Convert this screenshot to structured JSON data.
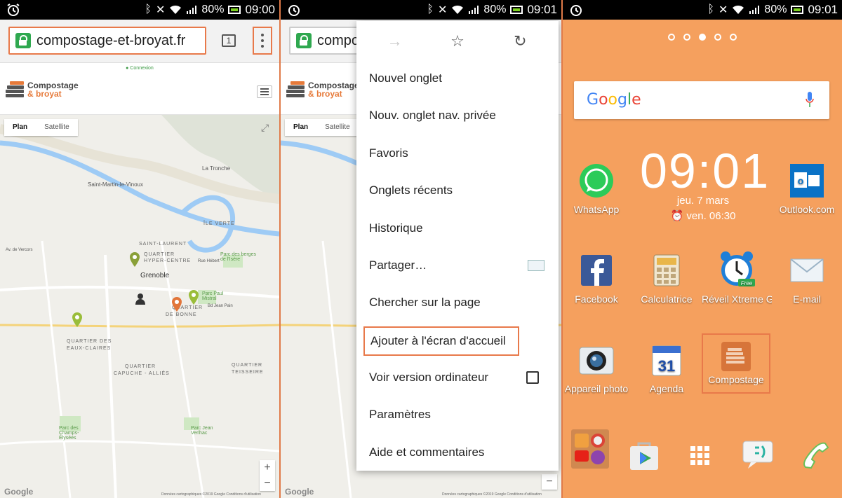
{
  "panel1": {
    "status": {
      "battery": "80%",
      "time": "09:00"
    },
    "url": "compostage-et-broyat.fr",
    "tab_count": "1",
    "site": {
      "login": "Connexion",
      "logo_line1": "Compostage",
      "logo_line2": "& broyat"
    },
    "map": {
      "type_plan": "Plan",
      "type_satellite": "Satellite",
      "labels": {
        "la_tronche": "La Tronche",
        "saint_martin": "Saint-Martin-le-Vinoux",
        "ile_verte": "ÎLE VERTE",
        "saint_laurent": "SAINT-LAURENT",
        "quartier_hyper": "QUARTIER",
        "hyper_centre": "HYPER-CENTRE",
        "grenoble": "Grenoble",
        "parc_berges": "Parc des berges de l'Isère",
        "parc_paul": "Parc Paul Mistral",
        "quartier_bonne": "QUARTIER",
        "de_bonne": "DE BONNE",
        "eaux_claires_1": "QUARTIER DES",
        "eaux_claires_2": "EAUX-CLAIRES",
        "capuche_1": "QUARTIER",
        "capuche_2": "CAPUCHE - ALLIÉS",
        "teisseire_1": "QUARTIER",
        "teisseire_2": "TEISSEIRE",
        "parc_champs": "Parc des Champs-Élysées",
        "parc_jean": "Parc Jean Verlhac",
        "av_vercors": "Av. de Vercors",
        "bd_jean_pain": "Bd Jean Pain",
        "rue_hebert": "Rue Hébert"
      },
      "footer": "Données cartographiques ©2019 Google   Conditions d'utilisation",
      "brand": "Google",
      "zoom_in": "+",
      "zoom_out": "−"
    }
  },
  "panel2": {
    "status": {
      "battery": "80%",
      "time": "09:01"
    },
    "url_partial": "compo",
    "menu": {
      "items": [
        "Nouvel onglet",
        "Nouv. onglet nav. privée",
        "Favoris",
        "Onglets récents",
        "Historique",
        "Partager…",
        "Chercher sur la page",
        "Ajouter à l'écran d'accueil",
        "Voir version ordinateur",
        "Paramètres",
        "Aide et commentaires"
      ]
    }
  },
  "panel3": {
    "status": {
      "battery": "80%",
      "time": "09:01"
    },
    "search_brand": "Google",
    "clock": {
      "time": "09:01",
      "date": "jeu. 7 mars",
      "alarm": "ven. 06:30"
    },
    "apps": {
      "whatsapp": "WhatsApp",
      "outlook": "Outlook.com",
      "facebook": "Facebook",
      "calculatrice": "Calculatrice",
      "reveil": "Réveil Xtreme G",
      "reveil_badge": "Free",
      "email": "E-mail",
      "appareil": "Appareil photo",
      "agenda": "Agenda",
      "agenda_day": "31",
      "compostage": "Compostage"
    }
  },
  "colors": {
    "accent": "#e8794a",
    "home_bg": "#f5a05e",
    "lock_green": "#2fa84f"
  }
}
